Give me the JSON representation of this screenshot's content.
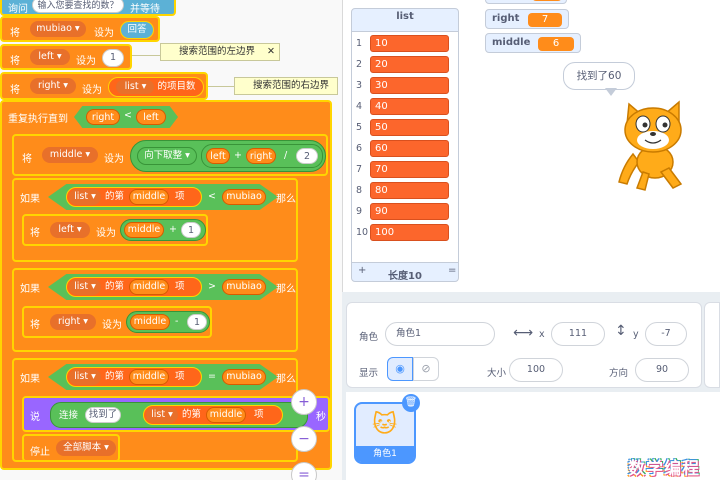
{
  "code": {
    "top_block": {
      "label": "询问",
      "prompt": "输入您要查找的数？",
      "tail": "并等待"
    },
    "set_mubiao": {
      "set": "将",
      "var": "mubiao",
      "to": "设为",
      "value": "回答"
    },
    "set_left": {
      "set": "将",
      "var": "left",
      "to": "设为",
      "value": "1"
    },
    "note_left": "搜索范围的左边界",
    "set_right": {
      "set": "将",
      "var": "right",
      "to": "设为",
      "list": "list",
      "tail": "的项目数"
    },
    "note_right": "搜索范围的右边界",
    "repeat_until": {
      "label": "重复执行直到",
      "left": "right",
      "op": "<",
      "right": "left"
    },
    "set_middle": {
      "set": "将",
      "var": "middle",
      "to": "设为",
      "func": "向下取整",
      "a": "left",
      "plus": "+",
      "b": "right",
      "div": "/",
      "n": "2"
    },
    "if1": {
      "if": "如果",
      "list": "list",
      "di": "的第",
      "idx": "middle",
      "xiang": "项",
      "op": "<",
      "cmp": "mubiao",
      "then": "那么"
    },
    "set_left2": {
      "set": "将",
      "var": "left",
      "to": "设为",
      "a": "middle",
      "plus": "+",
      "n": "1"
    },
    "if2": {
      "if": "如果",
      "list": "list",
      "di": "的第",
      "idx": "middle",
      "xiang": "项",
      "op": ">",
      "cmp": "mubiao",
      "then": "那么"
    },
    "set_right2": {
      "set": "将",
      "var": "right",
      "to": "设为",
      "a": "middle",
      "minus": "-",
      "n": "1"
    },
    "if3": {
      "if": "如果",
      "list": "list",
      "di": "的第",
      "idx": "middle",
      "xiang": "项",
      "op": "=",
      "cmp": "mubiao",
      "then": "那么"
    },
    "say": {
      "say": "说",
      "join": "连接",
      "found": "找到了",
      "list": "list",
      "di": "的第",
      "idx": "middle",
      "xiang": "项",
      "secs": "秒"
    },
    "stop": {
      "label": "停止",
      "option": "全部脚本"
    }
  },
  "zoom": {
    "in": "+",
    "out": "−",
    "reset": "="
  },
  "stage": {
    "list_monitor": {
      "title": "list",
      "items": [
        "10",
        "20",
        "30",
        "40",
        "50",
        "60",
        "70",
        "80",
        "90",
        "100"
      ],
      "add": "+",
      "length_label": "长度10",
      "resize": "="
    },
    "var_right": {
      "name": "right",
      "value": "7"
    },
    "var_middle": {
      "name": "middle",
      "value": "6"
    },
    "speech": "找到了60"
  },
  "sprite_info": {
    "sprite_label": "角色",
    "sprite_name": "角色1",
    "x_label": "x",
    "x_value": "111",
    "y_label": "y",
    "y_value": "-7",
    "show_label": "显示",
    "size_label": "大小",
    "size_value": "100",
    "direction_label": "方向",
    "direction_value": "90"
  },
  "sprite_list": [
    {
      "name": "角色1"
    }
  ],
  "watermark": "数学编程"
}
